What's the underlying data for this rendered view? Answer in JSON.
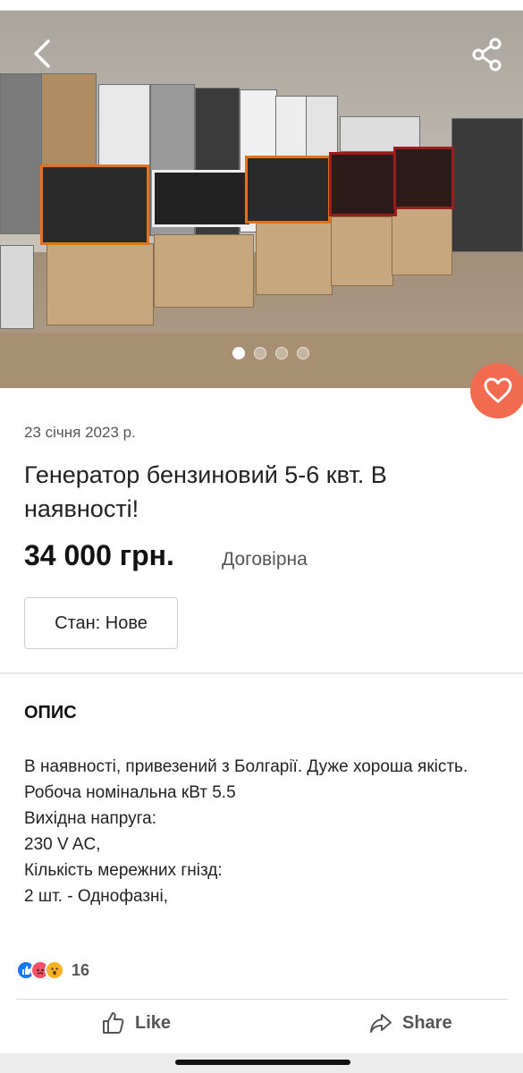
{
  "listing": {
    "date": "23 січня 2023 р.",
    "title": "Генератор бензиновий 5-6 квт. В наявності!",
    "price": "34 000 грн.",
    "negotiable": "Договірна",
    "condition": "Стан: Нове"
  },
  "gallery": {
    "photo_count": 4,
    "active_index": 0
  },
  "description": {
    "heading": "ОПИС",
    "lines": [
      "В наявності, привезений з Болгарії. Дуже хороша якість.",
      "Робоча номінальна кВт 5.5",
      "Вихідна напруга:",
      "230 V AC,",
      "Кількість мережних гнізд:",
      "2 шт. - Однофазні,"
    ]
  },
  "social": {
    "reaction_count": "16",
    "like_label": "Like",
    "share_label": "Share"
  },
  "colors": {
    "accent": "#f26a4f",
    "like_blue": "#1877f2"
  },
  "icons": [
    "back-icon",
    "share-network-icon",
    "heart-icon",
    "thumbs-up-icon",
    "share-arrow-icon"
  ]
}
